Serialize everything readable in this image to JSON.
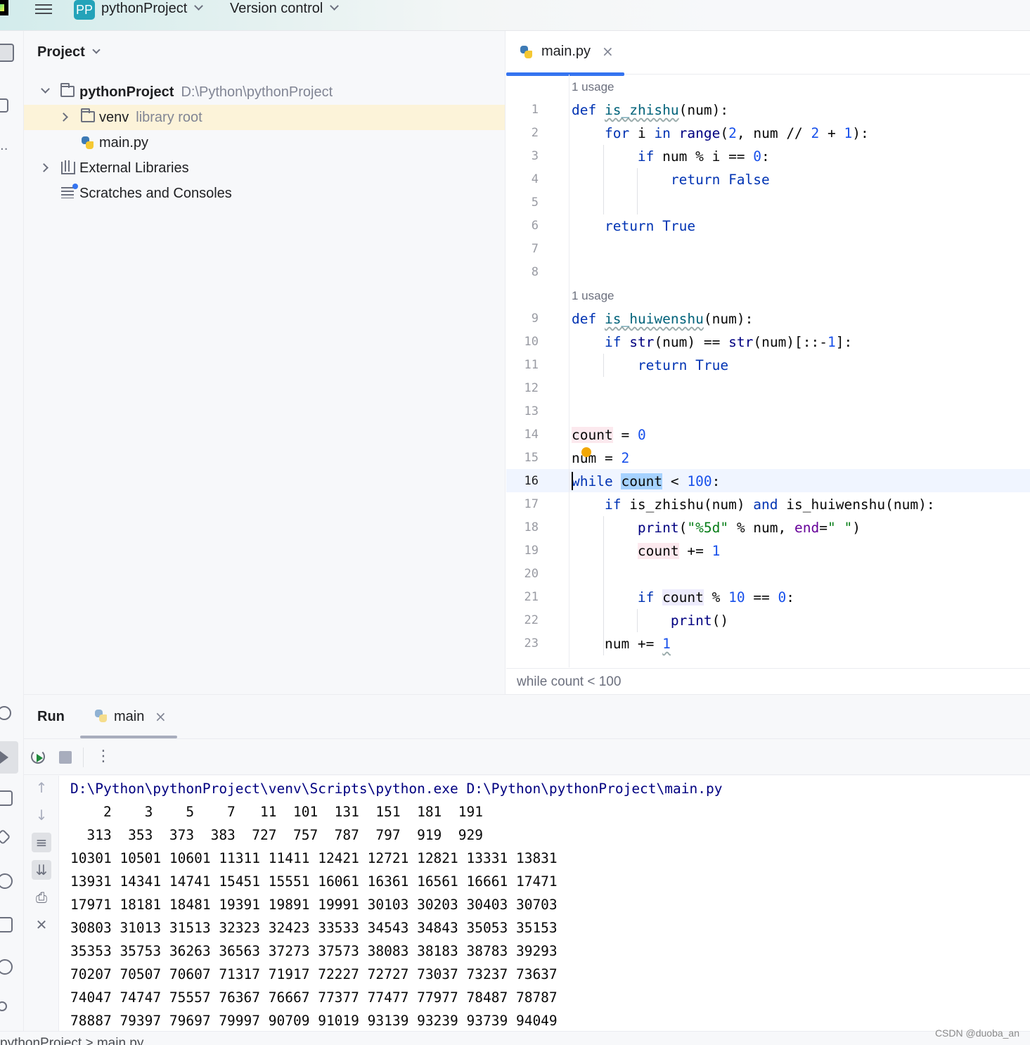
{
  "topbar": {
    "project_badge": "PP",
    "project_name": "pythonProject",
    "vcs_label": "Version control"
  },
  "project_panel": {
    "header": "Project",
    "tree": [
      {
        "label": "pythonProject",
        "hint": "D:\\Python\\pythonProject"
      },
      {
        "label": "venv",
        "hint": "library root"
      },
      {
        "label": "main.py",
        "hint": ""
      },
      {
        "label": "External Libraries",
        "hint": ""
      },
      {
        "label": "Scratches and Consoles",
        "hint": ""
      }
    ]
  },
  "editor": {
    "tab_label": "main.py",
    "tab_close": "×",
    "usage_hint": "1 usage",
    "current_line": 16,
    "line_numbers": [
      "1",
      "2",
      "3",
      "4",
      "5",
      "6",
      "7",
      "8",
      "9",
      "10",
      "11",
      "12",
      "13",
      "14",
      "15",
      "16",
      "17",
      "18",
      "19",
      "20",
      "21",
      "22",
      "23"
    ],
    "breadcrumb": "while count < 100"
  },
  "run_panel": {
    "title": "Run",
    "tab_label": "main",
    "tab_close": "×",
    "more": "⋮",
    "command": "D:\\Python\\pythonProject\\venv\\Scripts\\python.exe D:\\Python\\pythonProject\\main.py",
    "output": [
      "    2    3    5    7   11  101  131  151  181  191",
      "  313  353  373  383  727  757  787  797  919  929",
      "10301 10501 10601 11311 11411 12421 12721 12821 13331 13831",
      "13931 14341 14741 15451 15551 16061 16361 16561 16661 17471",
      "17971 18181 18481 19391 19891 19991 30103 30203 30403 30703",
      "30803 31013 31513 32323 32423 33533 34543 34843 35053 35153",
      "35353 35753 36263 36563 37273 37573 38083 38183 38783 39293",
      "70207 70507 70607 71317 71917 72227 72727 73037 73237 73637",
      "74047 74747 75557 76367 76667 77377 77477 77977 78487 78787",
      "78887 79397 79697 79997 90709 91019 93139 93239 93739 94049"
    ]
  },
  "statusbar": {
    "path": "pythonProject  >  main.py"
  },
  "watermark": "CSDN @duoba_an",
  "colors": {
    "accent": "#3574f0",
    "keyword": "#0033b3",
    "number": "#1750eb",
    "string": "#067d17",
    "selection": "#a6d2ff"
  },
  "icons": [
    "main-menu-icon",
    "folder-icon",
    "python-file-icon",
    "library-icon",
    "scratches-icon",
    "rerun-icon",
    "stop-icon",
    "scroll-up-icon",
    "scroll-down-icon",
    "soft-wrap-icon",
    "scroll-to-end-icon",
    "print-icon",
    "trash-icon"
  ]
}
